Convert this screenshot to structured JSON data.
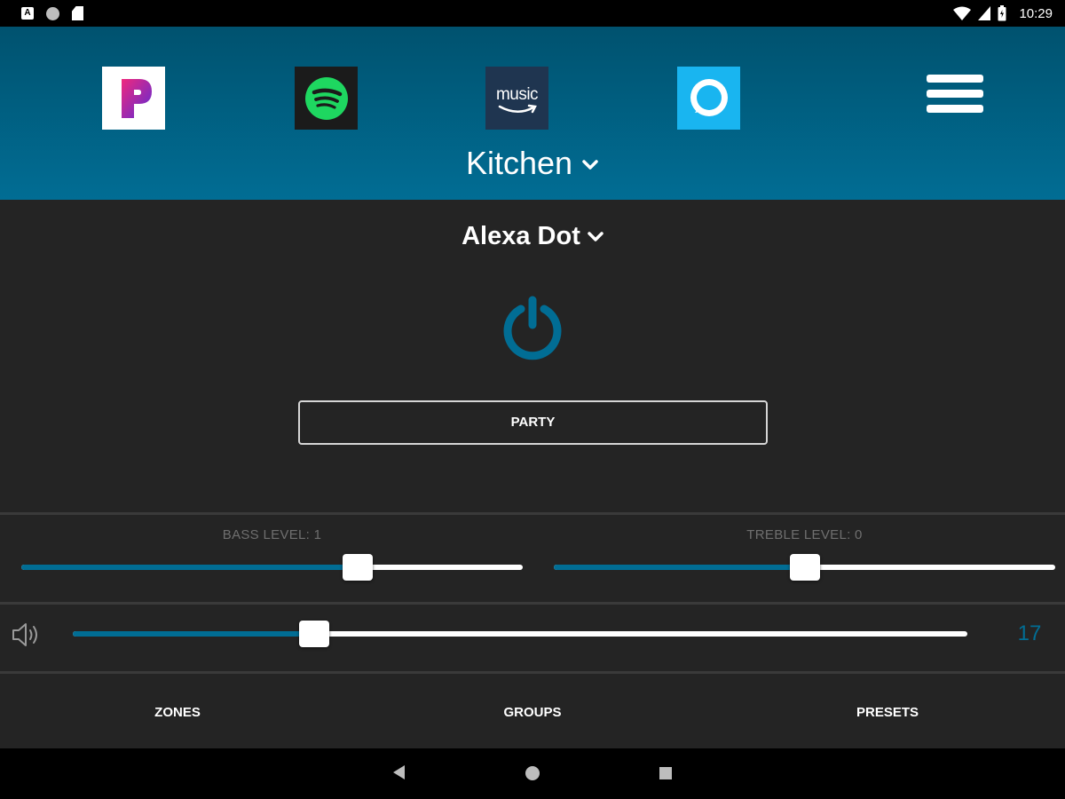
{
  "status_bar": {
    "time": "10:29",
    "icons": [
      "notification-a-icon",
      "circle-status-icon",
      "sd-card-icon",
      "wifi-icon",
      "signal-icon",
      "battery-icon"
    ]
  },
  "header": {
    "apps": [
      {
        "name": "Pandora",
        "icon": "pandora-icon",
        "color": "#e3157c"
      },
      {
        "name": "Spotify",
        "icon": "spotify-icon",
        "color": "#1ed760"
      },
      {
        "name": "Amazon Music",
        "icon": "amazon-music-icon",
        "label": "music",
        "color": "#1f3550"
      },
      {
        "name": "Alexa",
        "icon": "alexa-icon",
        "color": "#19b5f0"
      }
    ],
    "menu_icon": "hamburger-menu-icon",
    "zone": "Kitchen"
  },
  "main": {
    "source": "Alexa Dot",
    "power_icon": "power-icon",
    "party_label": "PARTY"
  },
  "tone": {
    "bass_label": "BASS LEVEL: 1",
    "bass_fraction": 0.67,
    "treble_label": "TREBLE LEVEL: 0",
    "treble_fraction": 0.5
  },
  "volume": {
    "value": "17",
    "fraction": 0.27,
    "icon": "speaker-icon"
  },
  "bottom_tabs": {
    "zones": "ZONES",
    "groups": "GROUPS",
    "presets": "PRESETS"
  },
  "colors": {
    "accent": "#016d94",
    "header_top": "#00526f",
    "background": "#242424"
  }
}
